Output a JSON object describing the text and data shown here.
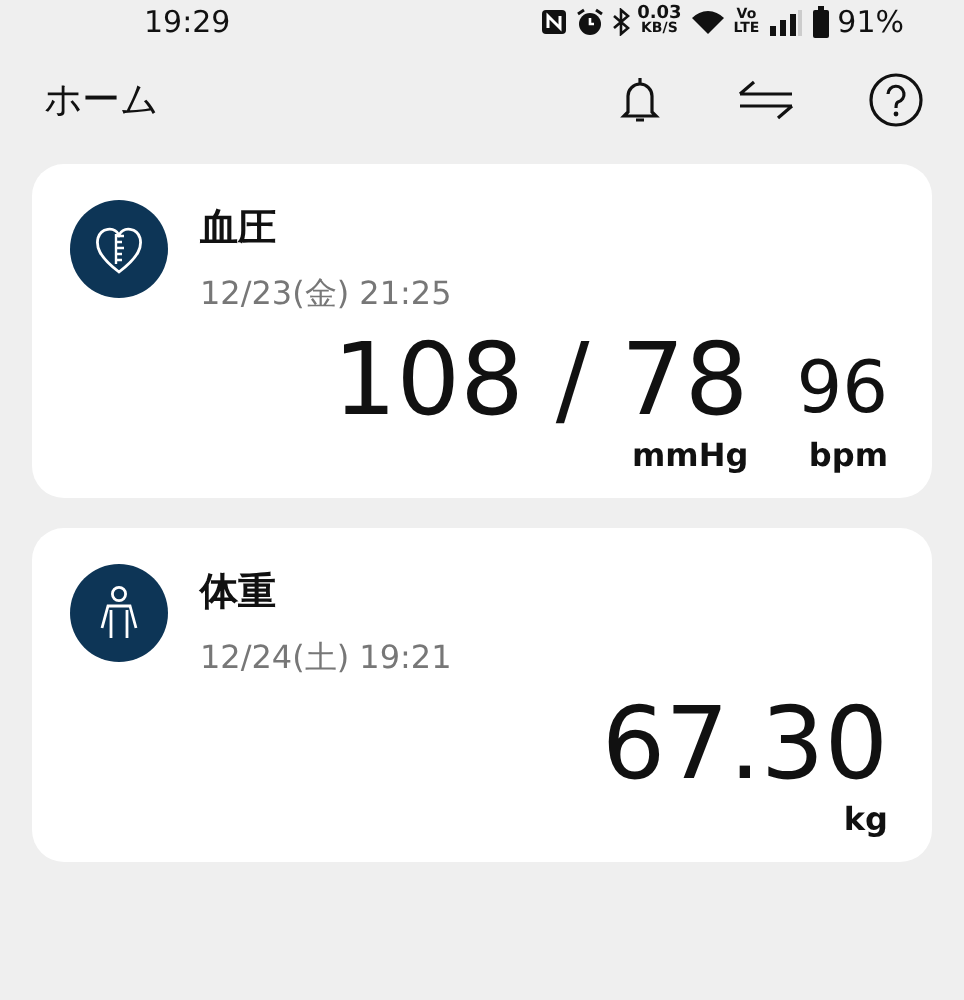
{
  "status_bar": {
    "time": "19:29",
    "speed": "0.03",
    "speed_unit": "KB/S",
    "volte_top": "Vo",
    "volte_bottom": "LTE",
    "battery": "91%"
  },
  "header": {
    "title": "ホーム"
  },
  "cards": [
    {
      "kind": "blood_pressure",
      "title": "血圧",
      "date": "12/23(金) 21:25",
      "readings": [
        {
          "kind": "primary",
          "value": "108 / 78",
          "unit": "mmHg"
        },
        {
          "kind": "secondary",
          "value": "96",
          "unit": "bpm"
        }
      ]
    },
    {
      "kind": "weight",
      "title": "体重",
      "date": "12/24(土) 19:21",
      "readings": [
        {
          "kind": "primary",
          "value": "67.30",
          "unit": "kg"
        }
      ]
    }
  ]
}
